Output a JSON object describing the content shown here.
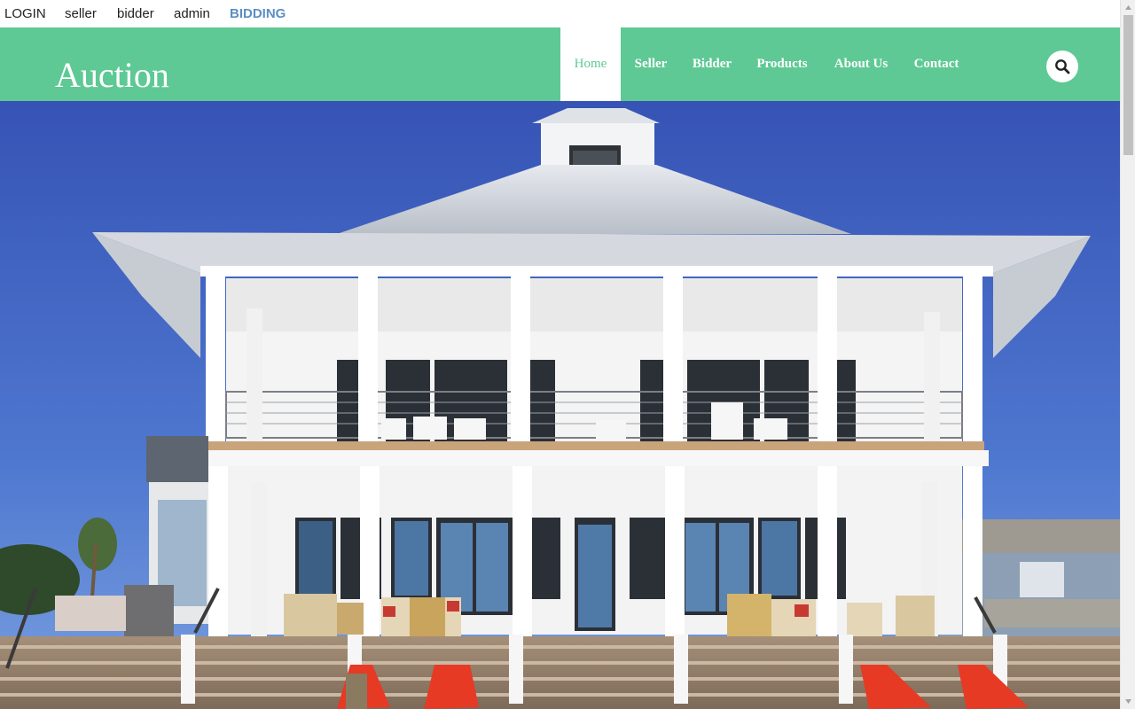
{
  "topbar": {
    "links": [
      "LOGIN",
      "seller",
      "bidder",
      "admin",
      "BIDDING"
    ]
  },
  "header": {
    "brand": "Auction",
    "nav": [
      {
        "label": "Home",
        "active": true
      },
      {
        "label": "Seller",
        "active": false
      },
      {
        "label": "Bidder",
        "active": false
      },
      {
        "label": "Products",
        "active": false
      },
      {
        "label": "About Us",
        "active": false
      },
      {
        "label": "Contact",
        "active": false
      }
    ],
    "search_icon": "search-icon"
  },
  "hero": {
    "image": "beach-house-photo"
  },
  "colors": {
    "accent": "#5ec994",
    "sky": "#4a6ec9",
    "bidding_link": "#5b8fc5"
  }
}
